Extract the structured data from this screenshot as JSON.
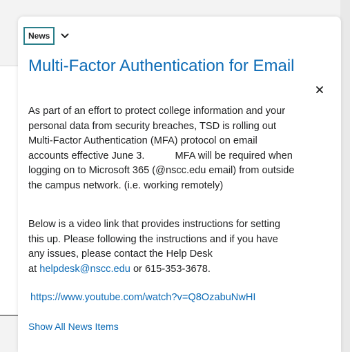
{
  "widget": {
    "category_label": "News",
    "title": "Multi-Factor Authentication for Email",
    "body": {
      "paragraph1_line1": "As part of an effort to protect college information and your",
      "paragraph1_line2": "personal data from security breaches, TSD is rolling out",
      "paragraph1_line3": "Multi-Factor Authentication (MFA) protocol on email",
      "paragraph1_line4a": "accounts effective June 3.",
      "paragraph1_line4b": "MFA will be required when",
      "paragraph1_line5": "logging on to Microsoft 365 (@nscc.edu email) from outside",
      "paragraph1_line6": "the campus network.  (i.e. working remotely)",
      "paragraph2_line1": "Below is a video link that provides instructions for setting",
      "paragraph2_line2": "this up.  Please following the instructions and if you have",
      "paragraph2_line3": "any issues, please contact the Help Desk",
      "paragraph2_at": "at ",
      "email_link": "helpdesk@nscc.edu",
      "paragraph2_after": " or 615-353-3678."
    },
    "video_link": "https://www.youtube.com/watch?v=Q8OzabuNwHI",
    "show_all_label": "Show All News Items"
  },
  "colors": {
    "link": "#0e6cb6",
    "text": "#202122",
    "focus_border": "#2a7f8a"
  },
  "icons": {
    "dropdown": "chevron-down-icon",
    "close": "close-icon"
  }
}
